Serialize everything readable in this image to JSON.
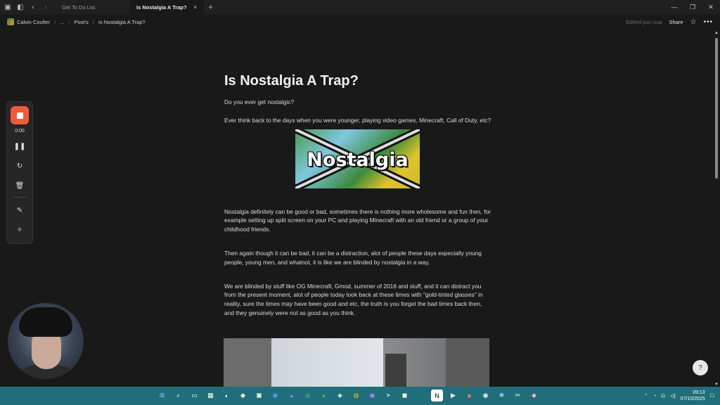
{
  "browser": {
    "tabs": [
      {
        "label": "Get To Do List",
        "active": false
      },
      {
        "label": "Is Nostalgia A Trap?",
        "active": true
      }
    ],
    "new_tab_label": "+"
  },
  "breadcrumb": {
    "workspace": "Calvin Coulter",
    "ellipsis": "...",
    "parent": "Post's",
    "current": "Is Nostalgia A Trap?"
  },
  "header": {
    "edited": "Edited just now",
    "share": "Share"
  },
  "page": {
    "title": "Is Nostalgia A Trap?",
    "paragraphs": [
      "Do you ever get nostalgic?",
      "Ever think back to the days when you were younger, playing video games, Minecraft, Call of Duty, etc?",
      "Nostalgia definitely can be good or bad, sometimes there is nothing more wholesome and fun then, for example setting up split screen on your PC and playing Minecraft with an old friend or a group of your childhood friends.",
      "Then again though it can be bad, it can be a distraction, alot of people these days especially young people, young men, and whatnot, it is like we are blinded by nostalgia in a way.",
      "We are blinded by stuff like OG Minecraft, Gmod, summer of 2016 and stuff, and it can distract you from the present moment, alot of people today look back at these times with \"gold-tinted glasses\" in reality, sure the times may have been good and etc, the truth is you forget the bad times back then, and they genuinely were not as good as you think."
    ],
    "image_text": "Nostalgia"
  },
  "recorder": {
    "time": "0:00"
  },
  "taskbar": {
    "time": "09:13",
    "date": "07/10/2025"
  },
  "colors": {
    "background": "#191919",
    "record_button": "#ef5a3a",
    "taskbar": "#1f6e7a"
  }
}
